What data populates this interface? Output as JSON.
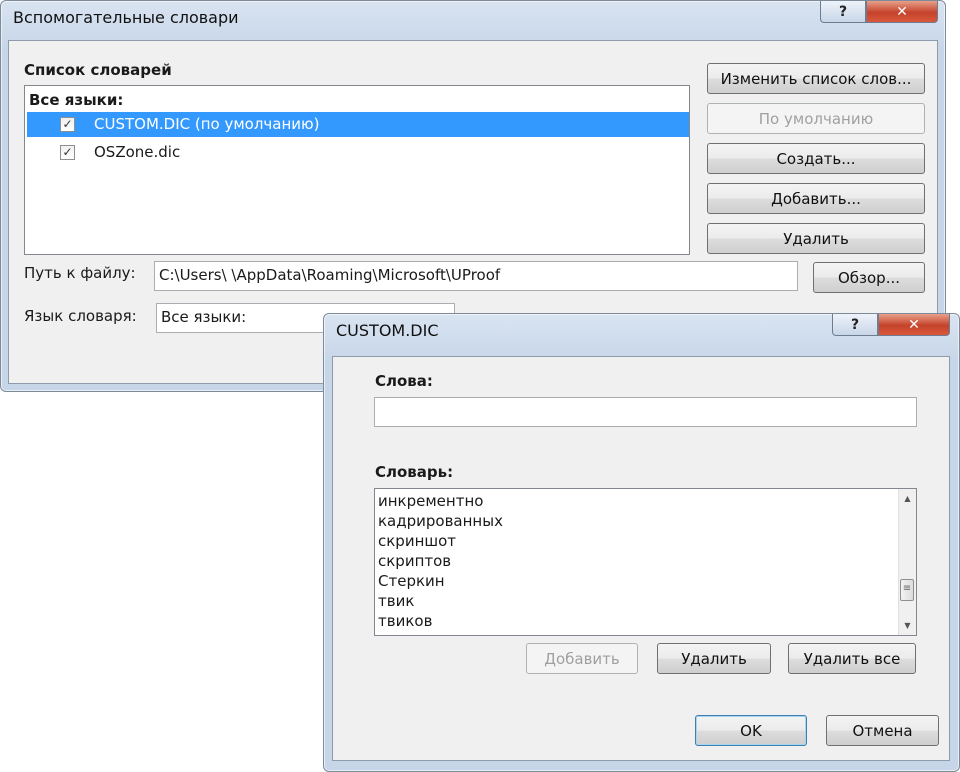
{
  "main_dialog": {
    "title": "Вспомогательные словари",
    "help_glyph": "?",
    "close_glyph": "✕",
    "list_group_label": "Список словарей",
    "list_header": "Все языки:",
    "dictionaries": [
      {
        "name": "CUSTOM.DIC (по умолчанию)",
        "checked": true,
        "selected": true
      },
      {
        "name": "OSZone.dic",
        "checked": true,
        "selected": false
      }
    ],
    "buttons": {
      "edit_list": "Изменить список слов...",
      "set_default": "По умолчанию",
      "create": "Создать...",
      "add": "Добавить...",
      "delete": "Удалить",
      "browse": "Обзор..."
    },
    "path_label": "Путь к файлу:",
    "path_value": "C:\\Users\\ \\AppData\\Roaming\\Microsoft\\UProof",
    "language_label": "Язык словаря:",
    "language_value": "Все языки:"
  },
  "custom_dialog": {
    "title": "CUSTOM.DIC",
    "help_glyph": "?",
    "close_glyph": "✕",
    "words_label": "Слова:",
    "words_value": "",
    "dictionary_label": "Словарь:",
    "words": [
      "инкрементно",
      "кадрированных",
      "скриншот",
      "скриптов",
      "Стеркин",
      "твик",
      "твиков"
    ],
    "buttons": {
      "add": "Добавить",
      "delete": "Удалить",
      "delete_all": "Удалить все",
      "ok": "OK",
      "cancel": "Отмена"
    }
  },
  "colors": {
    "selection": "#3399ff",
    "title_bar": "#c6d5e8",
    "close_button": "#c5422b"
  }
}
